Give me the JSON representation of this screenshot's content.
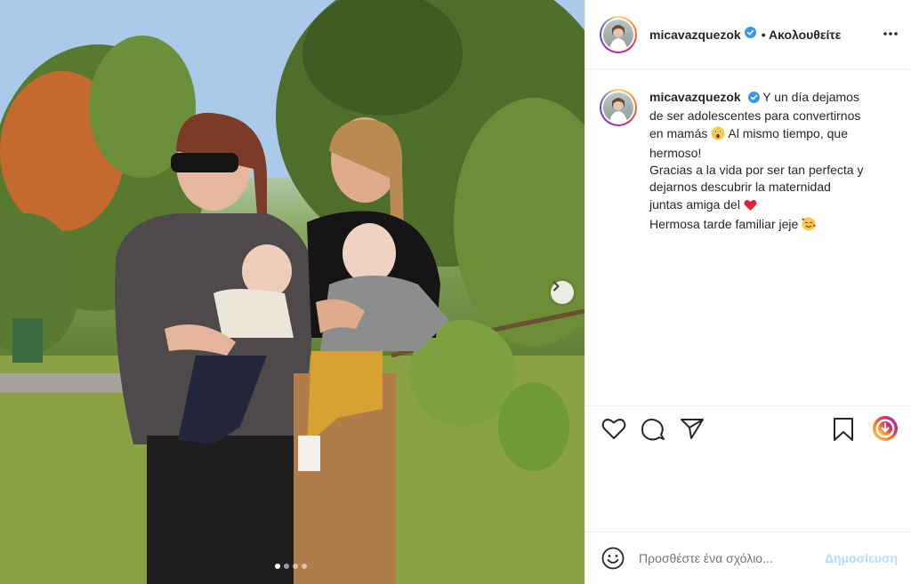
{
  "post": {
    "username": "micavazquezok",
    "follow_status": "• Ακολουθείτε",
    "caption_lines": [
      "Y un día dejamos",
      "de ser adolescentes para convertirnos",
      "en mamás",
      "Al mismo tiempo, que",
      "hermoso!",
      "Gracias a la vida por ser tan perfecta y",
      "dejarnos descubrir la maternidad",
      "juntas amiga del",
      "Hermosa tarde familiar jeje"
    ],
    "carousel": {
      "total_slides": 4,
      "current_slide": 1
    }
  },
  "comment": {
    "placeholder": "Προσθέστε ένα σχόλιο...",
    "post_label": "Δημοσίευση"
  },
  "icons": {
    "verified": "verified-badge-icon",
    "more": "more-options-icon",
    "like": "heart-icon",
    "comment": "comment-icon",
    "share": "paper-plane-icon",
    "save": "bookmark-icon",
    "emoji": "smiley-icon",
    "next": "chevron-right-icon"
  },
  "colors": {
    "verified": "#3897f0",
    "post_button_disabled": "#b2dffc",
    "text": "#262626",
    "muted": "#8e8e8e",
    "heart_emoji": "#e0243a"
  }
}
